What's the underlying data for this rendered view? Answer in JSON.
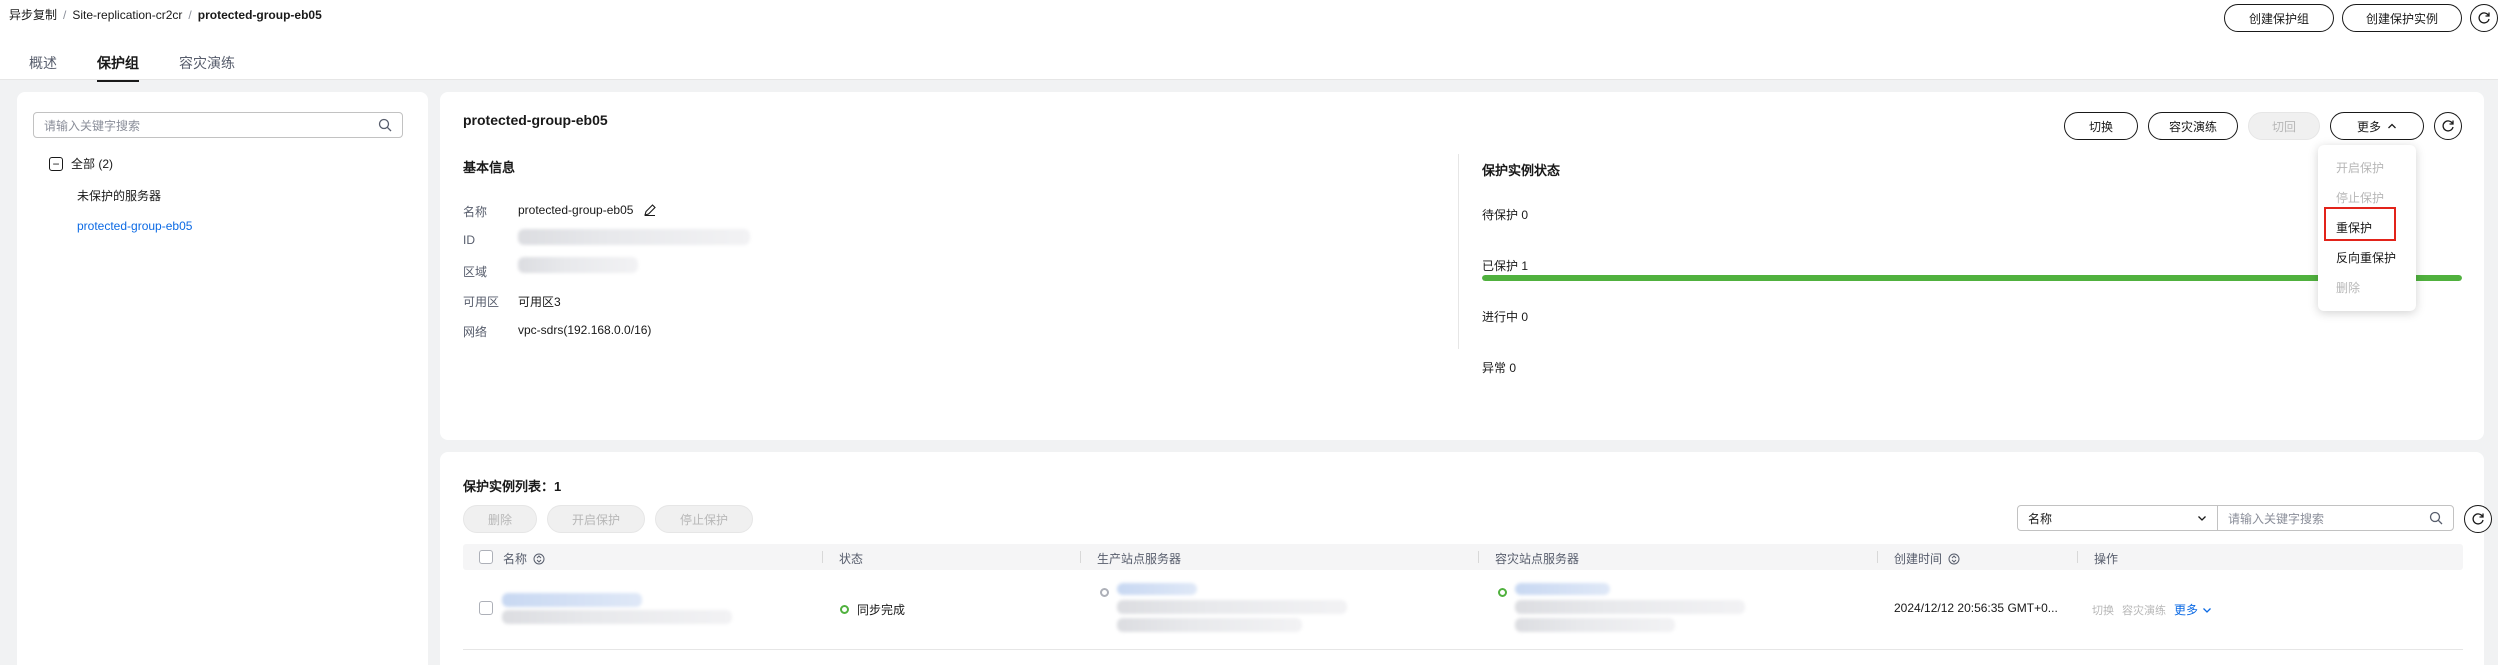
{
  "breadcrumb": [
    "异步复制",
    "Site-replication-cr2cr",
    "protected-group-eb05"
  ],
  "header_actions": {
    "create_group": "创建保护组",
    "create_instance": "创建保护实例"
  },
  "tabs": [
    "概述",
    "保护组",
    "容灾演练"
  ],
  "tree": {
    "search_placeholder": "请输入关键字搜索",
    "all": "全部 (2)",
    "unprotected": "未保护的服务器",
    "group": "protected-group-eb05"
  },
  "detail": {
    "title": "protected-group-eb05",
    "actions": {
      "switch": "切换",
      "drill": "容灾演练",
      "failover": "切回",
      "more": "更多"
    },
    "basic_info_title": "基本信息",
    "labels": {
      "name": "名称",
      "id": "ID",
      "region": "区域",
      "az": "可用区",
      "network": "网络"
    },
    "values": {
      "name": "protected-group-eb05",
      "az": "可用区3",
      "network": "vpc-sdrs(192.168.0.0/16)"
    },
    "status_title": "保护实例状态",
    "status": {
      "pending": "待保护 0",
      "protected": "已保护 1",
      "in_progress": "进行中 0",
      "abnormal": "异常 0"
    },
    "protected_fraction": 1.0
  },
  "more_menu": [
    "开启保护",
    "停止保护",
    "重保护",
    "反向重保护",
    "删除"
  ],
  "instances": {
    "title": "保护实例列表：1",
    "actions": [
      "删除",
      "开启保护",
      "停止保护"
    ],
    "filter_select": "名称",
    "filter_placeholder": "请输入关键字搜索",
    "columns": [
      "名称",
      "状态",
      "生产站点服务器",
      "容灾站点服务器",
      "创建时间",
      "操作"
    ],
    "row": {
      "status": "同步完成",
      "created": "2024/12/12 20:56:35 GMT+0...",
      "ops": [
        "切换",
        "容灾演练",
        "更多"
      ]
    }
  },
  "colors": {
    "accent": "#0c6ae4",
    "success": "#50b13e",
    "highlight": "#e2231a"
  }
}
